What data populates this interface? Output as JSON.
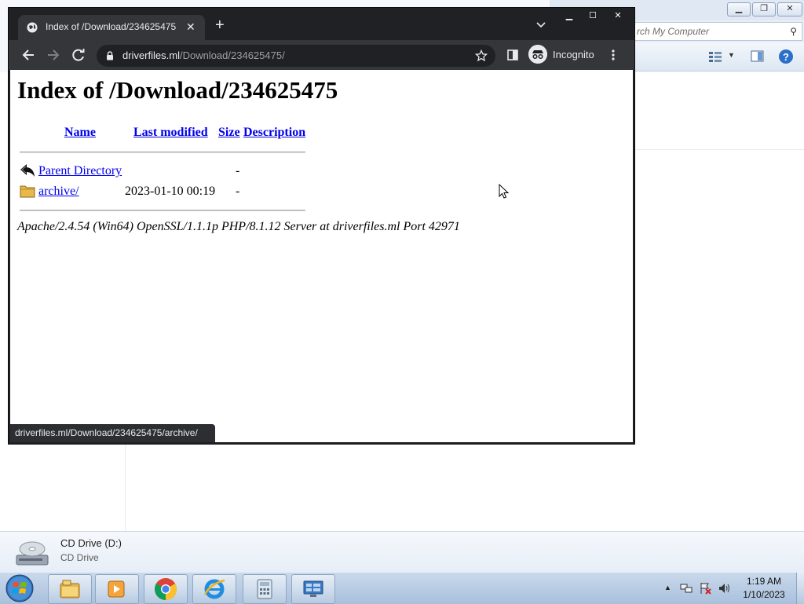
{
  "explorer": {
    "search_placeholder": "rch My Computer",
    "details": {
      "name": "CD Drive (D:)",
      "type": "CD Drive"
    }
  },
  "browser": {
    "tab_title": "Index of /Download/234625475",
    "url_host": "driverfiles.ml",
    "url_path": "/Download/234625475/",
    "profile_label": "Incognito",
    "status_url": "driverfiles.ml/Download/234625475/archive/"
  },
  "page": {
    "heading": "Index of /Download/234625475",
    "columns": {
      "name": "Name",
      "last_modified": "Last modified",
      "size": "Size",
      "description": "Description"
    },
    "rows": [
      {
        "name": "Parent Directory",
        "date": "",
        "size": "-",
        "icon": "back-arrow-icon"
      },
      {
        "name": "archive/",
        "date": "2023-01-10 00:19",
        "size": "-",
        "icon": "folder-icon"
      }
    ],
    "address": "Apache/2.4.54 (Win64) OpenSSL/1.1.1p PHP/8.1.12 Server at driverfiles.ml Port 42971"
  },
  "taskbar": {
    "time": "1:19 AM",
    "date": "1/10/2023",
    "apps": [
      "file-explorer-icon",
      "media-player-icon",
      "chrome-icon",
      "internet-explorer-icon",
      "calculator-icon",
      "remote-desktop-icon"
    ]
  }
}
